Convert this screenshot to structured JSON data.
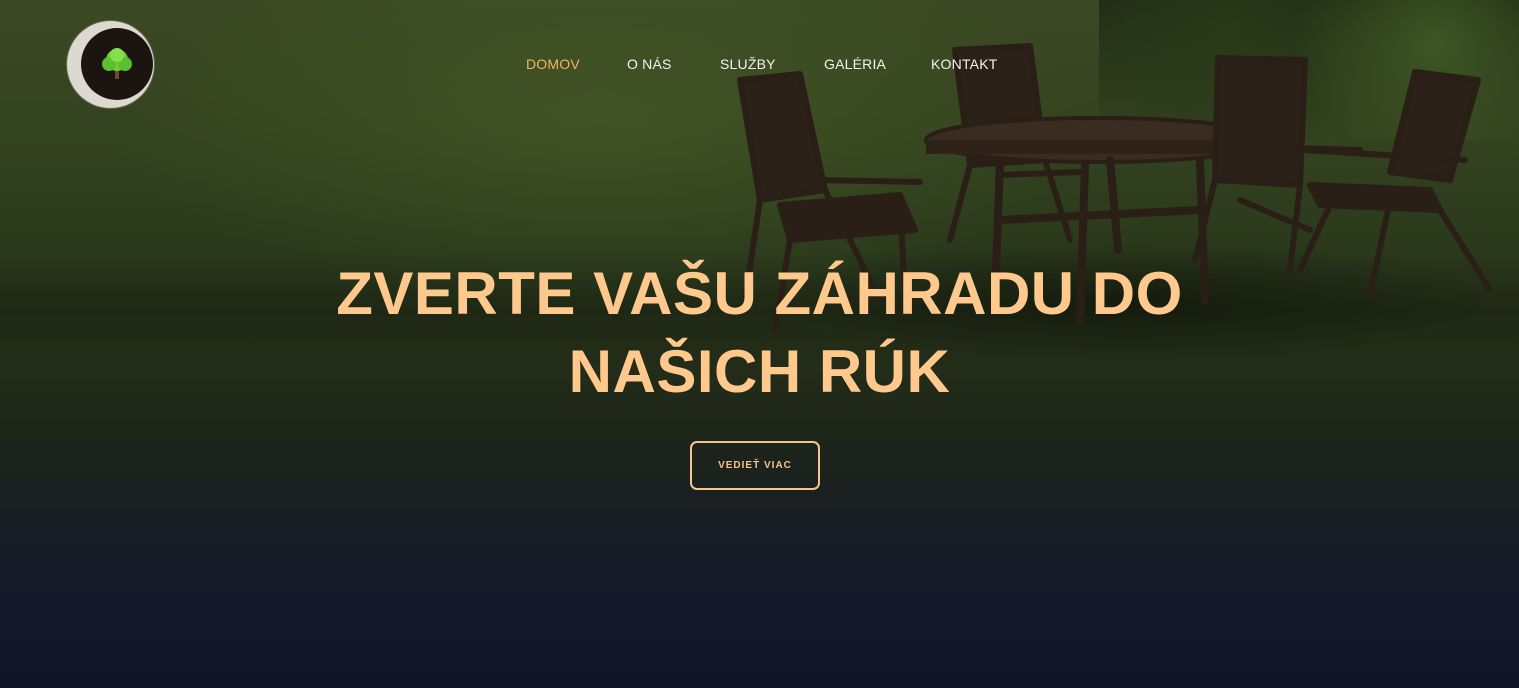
{
  "nav": {
    "items": [
      {
        "label": "DOMOV",
        "active": true
      },
      {
        "label": "O NÁS",
        "active": false
      },
      {
        "label": "SLUŽBY",
        "active": false
      },
      {
        "label": "GALÉRIA",
        "active": false
      },
      {
        "label": "KONTAKT",
        "active": false
      }
    ]
  },
  "hero": {
    "headline_line1": "ZVERTE VAŠU ZÁHRADU DO",
    "headline_line2": "NAŠICH RÚK",
    "cta_label": "VEDIEŤ VIAC"
  },
  "colors": {
    "accent": "#f7b267",
    "headline": "#ffc98d",
    "nav_text": "#f2f2f2",
    "background_dark": "#121528",
    "lawn": "#34431f"
  },
  "icons": {
    "logo": "tree-icon"
  }
}
